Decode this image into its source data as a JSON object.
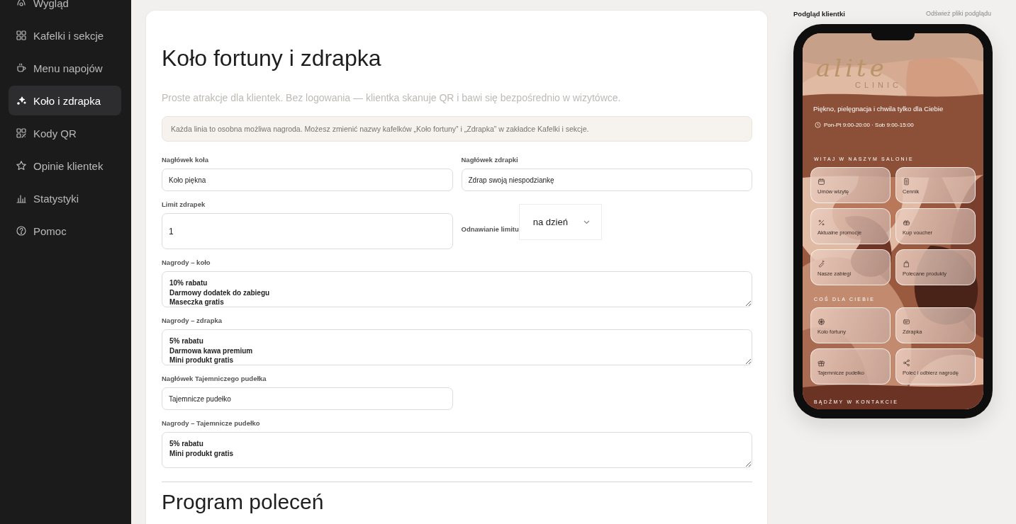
{
  "sidebar": {
    "items": [
      {
        "label": "Wygląd",
        "selected": false
      },
      {
        "label": "Kafelki i sekcje",
        "selected": false
      },
      {
        "label": "Menu napojów",
        "selected": false
      },
      {
        "label": "Koło i zdrapka",
        "selected": true
      },
      {
        "label": "Kody QR",
        "selected": false
      },
      {
        "label": "Opinie klientek",
        "selected": false
      },
      {
        "label": "Statystyki",
        "selected": false
      },
      {
        "label": "Pomoc",
        "selected": false
      }
    ]
  },
  "editor": {
    "title": "Koło fortuny i zdrapka",
    "subtitle": "Proste atrakcje dla klientek. Bez logowania — klientka skanuje QR i bawi się bezpośrednio w wizytówce.",
    "notice": "Każda linia to osobna możliwa nagroda. Możesz zmienić nazwy kafelków „Koło fortuny” i „Zdrapka” w zakładce Kafelki i sekcje.",
    "rows": [
      [
        {
          "kind": "text",
          "label": "Nagłówek koła",
          "value": "Koło piękna"
        },
        {
          "kind": "text",
          "label": "Nagłówek zdrapki",
          "value": "Zdrap swoją niespodziankę"
        }
      ],
      [
        {
          "kind": "number",
          "label": "Limit zdrapek",
          "value": "1"
        },
        {
          "kind": "select",
          "label": "Odnawianie limitu",
          "value": "na dzień"
        }
      ],
      [
        {
          "kind": "textarea",
          "label": "Nagrody – koło",
          "lines": [
            "10% rabatu",
            "Darmowy dodatek do zabiegu",
            "Maseczka gratis"
          ]
        }
      ],
      [
        {
          "kind": "textarea",
          "label": "Nagrody – zdrapka",
          "lines": [
            "5% rabatu",
            "Darmowa kawa premium",
            "Mini produkt gratis"
          ]
        }
      ],
      [
        {
          "kind": "text",
          "label": "Nagłówek Tajemniczego pudełka",
          "value": "Tajemnicze pudełko"
        }
      ],
      [
        {
          "kind": "textarea",
          "label": "Nagrody – Tajemnicze pudełko",
          "lines": [
            "5% rabatu",
            "Mini produkt gratis"
          ]
        }
      ]
    ],
    "next_section_title": "Program poleceń"
  },
  "preview": {
    "title": "Podgląd klientki",
    "refresh_link": "Odśwież pliki podglądu",
    "phone": {
      "logo": "alite",
      "logo_subtitle": "CLINIC",
      "tagline": "Piękno, pielęgnacja i chwila tylko dla Ciebie",
      "hours": "Pon-Pt 9:00-20:00 · Sob 9:00-15:00",
      "sections": [
        {
          "title": "WITAJ W NASZYM SALONIE",
          "tiles": [
            {
              "label": "Umów wizytę"
            },
            {
              "label": "Cennik"
            },
            {
              "label": "Aktualne promocje"
            },
            {
              "label": "Kup voucher"
            },
            {
              "label": "Nasze zabiegi"
            },
            {
              "label": "Polecane produkty"
            }
          ]
        },
        {
          "title": "COŚ DLA CIEBIE",
          "tiles": [
            {
              "label": "Koło fortuny"
            },
            {
              "label": "Zdrapka"
            },
            {
              "label": "Tajemnicze pudełko"
            },
            {
              "label": "Poleć i odbierz nagrodę"
            }
          ]
        }
      ],
      "contact_title": "BĄDŹMY W KONTAKCIE"
    }
  }
}
